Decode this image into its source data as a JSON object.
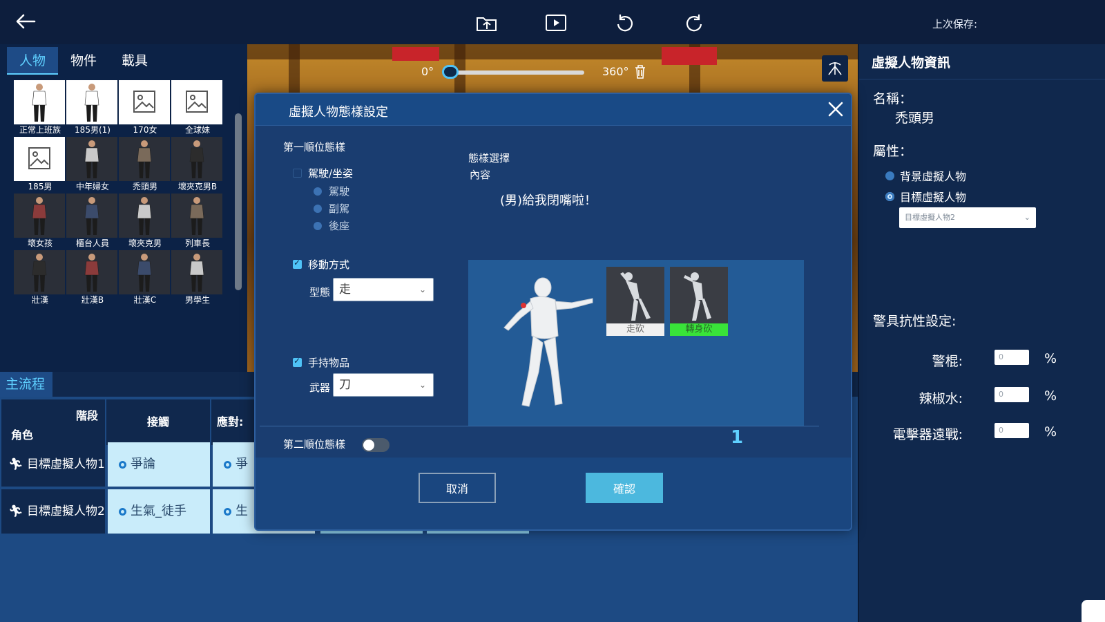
{
  "topbar": {
    "last_save_label": "上次保存:"
  },
  "asset_panel": {
    "tabs": [
      "人物",
      "物件",
      "載具"
    ],
    "items": [
      {
        "label": "正常上班族",
        "placeholder": false
      },
      {
        "label": "185男(1)",
        "placeholder": false
      },
      {
        "label": "170女",
        "placeholder": true
      },
      {
        "label": "全球妹",
        "placeholder": true
      },
      {
        "label": "185男",
        "placeholder": true
      },
      {
        "label": "中年婦女",
        "placeholder": false
      },
      {
        "label": "禿頭男",
        "placeholder": false
      },
      {
        "label": "壞夾克男B",
        "placeholder": false
      },
      {
        "label": "壞女孩",
        "placeholder": false
      },
      {
        "label": "櫃台人員",
        "placeholder": false
      },
      {
        "label": "壞夾克男",
        "placeholder": false
      },
      {
        "label": "列車長",
        "placeholder": false
      },
      {
        "label": "壯漢",
        "placeholder": false
      },
      {
        "label": "壯漢B",
        "placeholder": false
      },
      {
        "label": "壯漢C",
        "placeholder": false
      },
      {
        "label": "男學生",
        "placeholder": false
      }
    ]
  },
  "viewport": {
    "rotation_min": "0°",
    "rotation_max": "360°",
    "rotation_value": 0
  },
  "info_panel": {
    "title": "虛擬人物資訊",
    "name_label": "名稱：",
    "name_value": "禿頭男",
    "attr_label": "屬性：",
    "attr_options": [
      "背景虛擬人物",
      "目標虛擬人物"
    ],
    "attr_selected": 1,
    "target_select": "目標虛擬人物2",
    "resistance_title": "警具抗性設定:",
    "resistances": [
      {
        "label": "警棍:",
        "value": "0",
        "unit": "%"
      },
      {
        "label": "辣椒水:",
        "value": "0",
        "unit": "%"
      },
      {
        "label": "電擊器遠戰:",
        "value": "0",
        "unit": "%"
      }
    ]
  },
  "flow": {
    "tab": "主流程",
    "header_stage": "階段",
    "header_role": "角色",
    "columns": [
      "接觸",
      "應對:"
    ],
    "rows": [
      {
        "role": "目標虛擬人物1",
        "cells": [
          "爭論",
          "爭"
        ]
      },
      {
        "role": "目標虛擬人物2",
        "cells": [
          "生氣_徒手",
          "生"
        ]
      }
    ]
  },
  "modal": {
    "title": "虛擬人物態樣設定",
    "first_priority": "第一順位態樣",
    "drive_sit": {
      "label": "駕駛/坐姿",
      "checked": false,
      "options": [
        "駕駛",
        "副駕",
        "後座"
      ]
    },
    "movement": {
      "label": "移動方式",
      "checked": true,
      "type_label": "型態",
      "type_value": "走"
    },
    "handheld": {
      "label": "手持物品",
      "checked": true,
      "weapon_label": "武器",
      "weapon_value": "刀"
    },
    "pose_select_label": "態樣選擇",
    "content_label": "內容",
    "content_text": "(男)給我閉嘴啦！",
    "poses": [
      {
        "label": "走砍",
        "selected": false
      },
      {
        "label": "轉身砍",
        "selected": true
      }
    ],
    "page_number": "1",
    "second_priority": "第二順位態樣",
    "second_enabled": false,
    "cancel_label": "取消",
    "confirm_label": "確認"
  }
}
